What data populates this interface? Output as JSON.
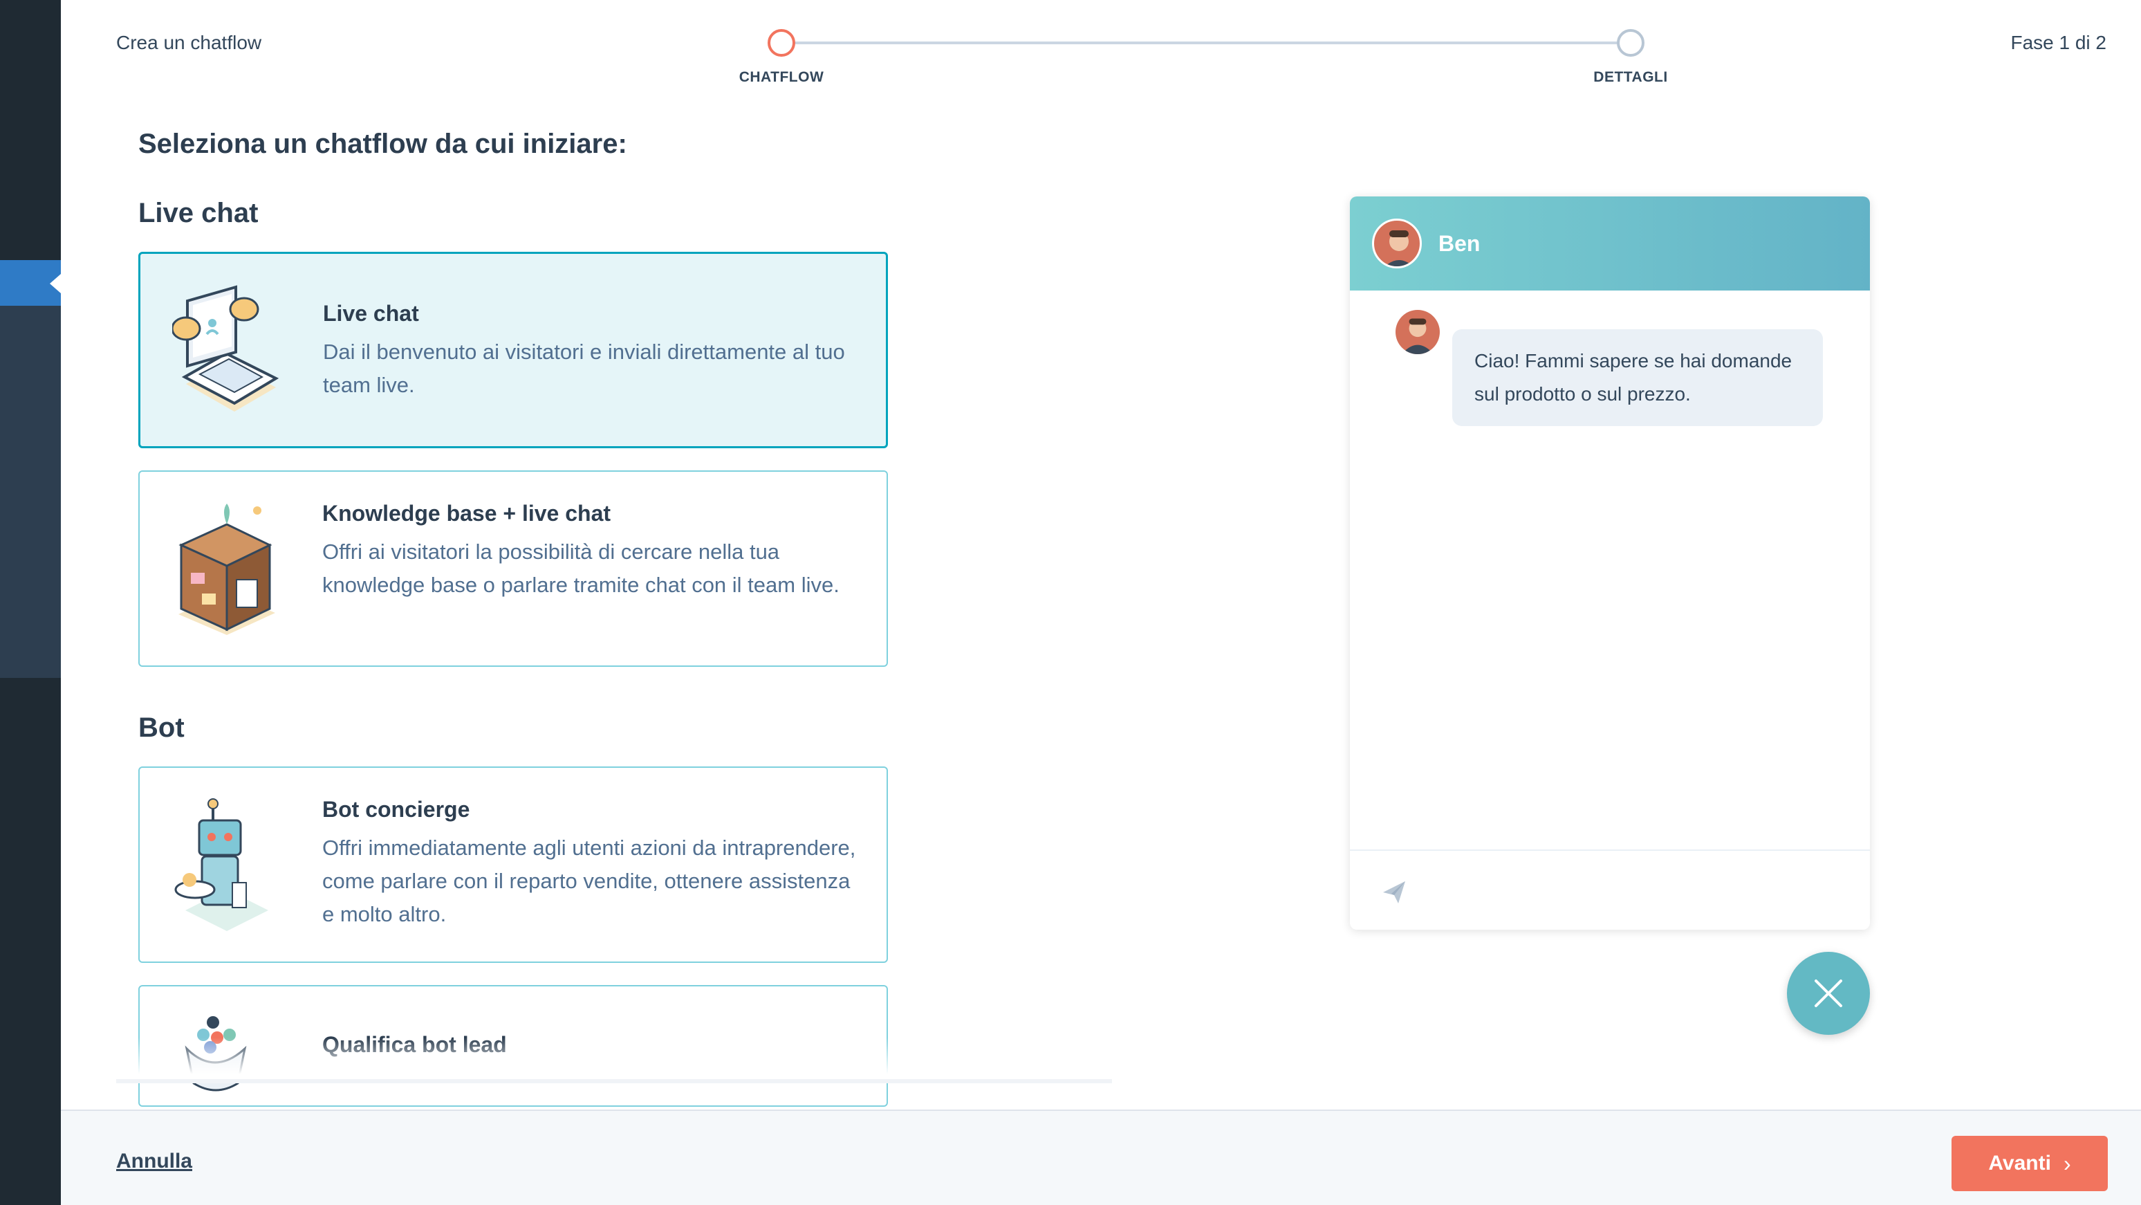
{
  "header": {
    "title": "Crea un chatflow",
    "phase": "Fase 1 di 2",
    "steps": [
      {
        "label": "CHATFLOW",
        "active": true
      },
      {
        "label": "DETTAGLI",
        "active": false
      }
    ]
  },
  "main": {
    "heading": "Seleziona un chatflow da cui iniziare:",
    "sections": [
      {
        "title": "Live chat",
        "cards": [
          {
            "title": "Live chat",
            "description": "Dai il benvenuto ai visitatori e inviali direttamente al tuo team live.",
            "selected": true,
            "icon": "laptop-chat-illustration"
          },
          {
            "title": "Knowledge base + live chat",
            "description": "Offri ai visitatori la possibilità di cercare nella tua knowledge base o parlare tramite chat con il team live.",
            "selected": false,
            "icon": "filing-cabinet-illustration"
          }
        ]
      },
      {
        "title": "Bot",
        "cards": [
          {
            "title": "Bot concierge",
            "description": "Offri immediatamente agli utenti azioni da intraprendere, come parlare con il reparto vendite, ottenere assistenza e molto altro.",
            "selected": false,
            "icon": "robot-illustration"
          },
          {
            "title": "Qualifica bot lead",
            "description": "",
            "selected": false,
            "icon": "funnel-illustration"
          }
        ]
      }
    ]
  },
  "chat_preview": {
    "agent_name": "Ben",
    "message": "Ciao! Fammi sapere se hai domande sul prodotto o sul prezzo.",
    "send_icon": "paper-plane-icon",
    "close_icon": "close-icon"
  },
  "footer": {
    "cancel_label": "Annulla",
    "next_label": "Avanti"
  },
  "colors": {
    "accent": "#f2745e",
    "selected_border": "#00a4bd",
    "selected_bg": "#e5f5f8",
    "sidebar_dark": "#1f2a33",
    "sidebar_active": "#2f7bc6",
    "chat_header": "#6bbfcb"
  }
}
